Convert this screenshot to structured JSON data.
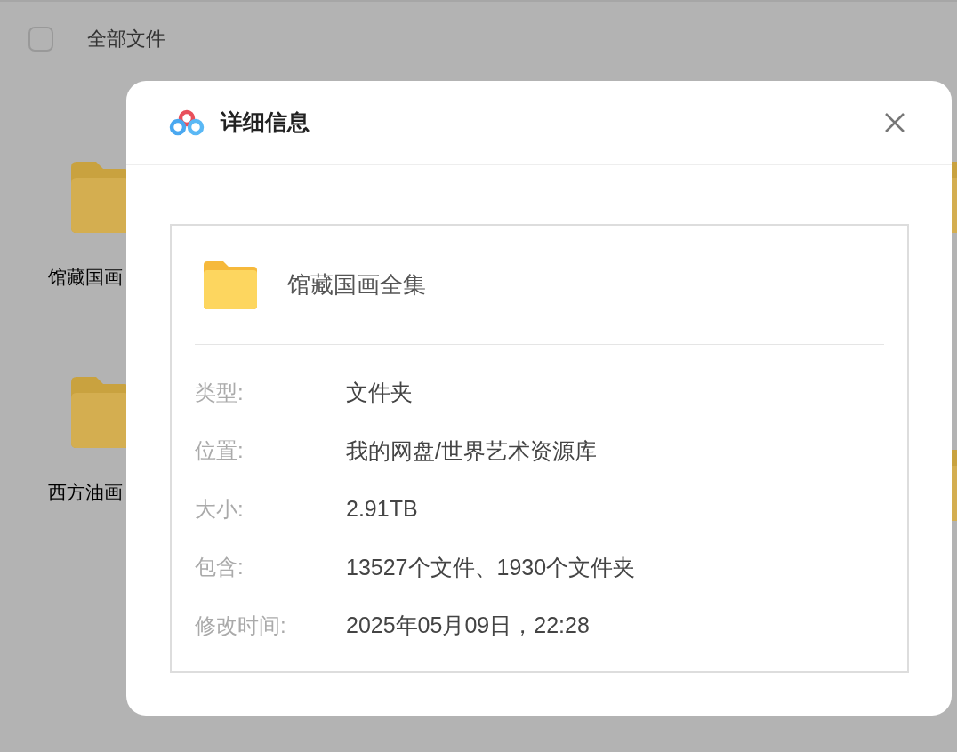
{
  "header": {
    "select_all_checked": false,
    "title": "全部文件"
  },
  "folders": [
    {
      "name": "馆藏国画"
    },
    {
      "name": "西方油画"
    }
  ],
  "dialog": {
    "title": "详细信息",
    "file": {
      "name": "馆藏国画全集"
    },
    "details": [
      {
        "label": "类型:",
        "value": "文件夹"
      },
      {
        "label": "位置:",
        "value": "我的网盘/世界艺术资源库"
      },
      {
        "label": "大小:",
        "value": "2.91TB"
      },
      {
        "label": "包含:",
        "value": "13527个文件、1930个文件夹"
      },
      {
        "label": "修改时间:",
        "value": "2025年05月09日，22:28"
      }
    ]
  }
}
